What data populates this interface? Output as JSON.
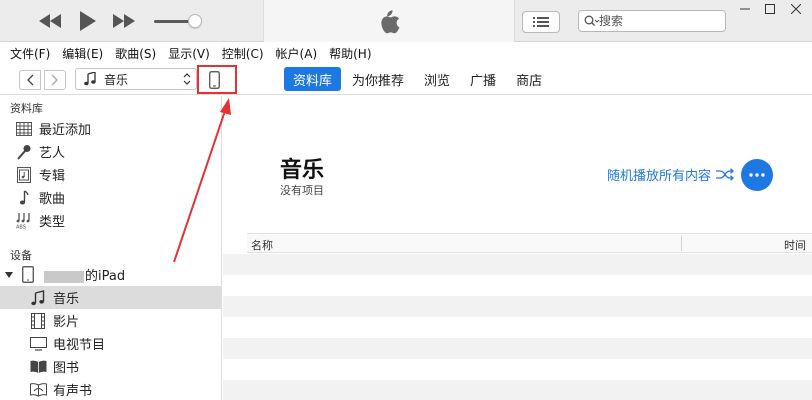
{
  "player": {
    "prev_icon": "rewind-icon",
    "play_icon": "play-icon",
    "next_icon": "fast-forward-icon",
    "volume_level": 0.8,
    "logo_icon": "apple-logo-icon",
    "list_icon": "list-icon",
    "search_placeholder": "搜索"
  },
  "menubar": {
    "items": [
      "文件(F)",
      "编辑(E)",
      "歌曲(S)",
      "显示(V)",
      "控制(C)",
      "帐户(A)",
      "帮助(H)"
    ]
  },
  "nav": {
    "media_label": "音乐",
    "tabs": [
      {
        "label": "资料库",
        "active": true
      },
      {
        "label": "为你推荐",
        "active": false
      },
      {
        "label": "浏览",
        "active": false
      },
      {
        "label": "广播",
        "active": false
      },
      {
        "label": "商店",
        "active": false
      }
    ]
  },
  "sidebar": {
    "library_title": "资料库",
    "library_items": [
      {
        "label": "最近添加",
        "icon": "grid-icon"
      },
      {
        "label": "艺人",
        "icon": "microphone-icon"
      },
      {
        "label": "专辑",
        "icon": "album-icon"
      },
      {
        "label": "歌曲",
        "icon": "music-note-icon"
      },
      {
        "label": "类型",
        "icon": "genre-icon"
      }
    ],
    "devices_title": "设备",
    "device_name_suffix": "的iPad",
    "device_items": [
      {
        "label": "音乐",
        "icon": "music-note-icon",
        "selected": true
      },
      {
        "label": "影片",
        "icon": "film-icon",
        "selected": false
      },
      {
        "label": "电视节目",
        "icon": "tv-icon",
        "selected": false
      },
      {
        "label": "图书",
        "icon": "book-icon",
        "selected": false
      },
      {
        "label": "有声书",
        "icon": "audiobook-icon",
        "selected": false
      }
    ]
  },
  "main": {
    "title": "音乐",
    "subtitle": "没有项目",
    "shuffle_label": "随机播放所有内容",
    "columns": [
      "名称",
      "时间"
    ]
  },
  "colors": {
    "accent": "#1e78e1",
    "highlight": "#e53333"
  }
}
